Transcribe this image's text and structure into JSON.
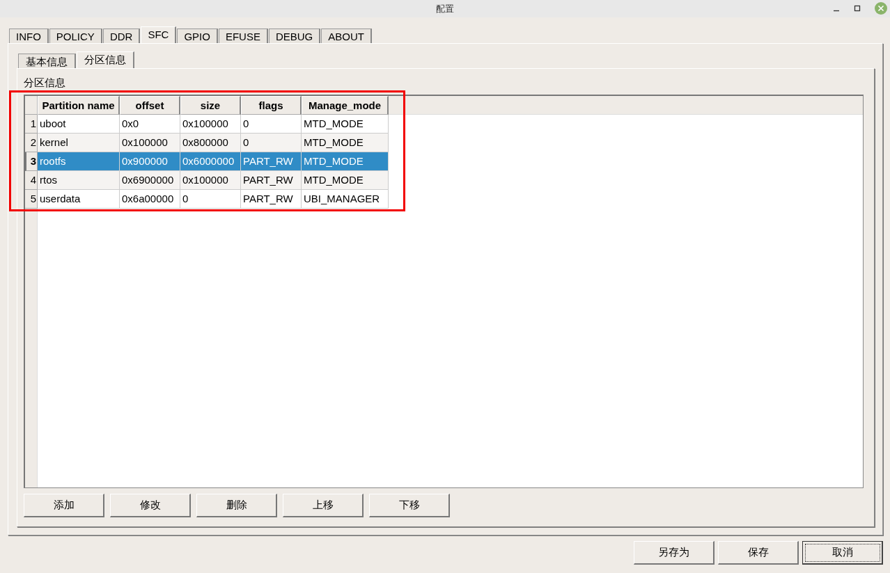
{
  "window": {
    "title": "配置"
  },
  "tabs": [
    {
      "label": "INFO",
      "selected": false
    },
    {
      "label": "POLICY",
      "selected": false
    },
    {
      "label": "DDR",
      "selected": false
    },
    {
      "label": "SFC",
      "selected": true
    },
    {
      "label": "GPIO",
      "selected": false
    },
    {
      "label": "EFUSE",
      "selected": false
    },
    {
      "label": "DEBUG",
      "selected": false
    },
    {
      "label": "ABOUT",
      "selected": false
    }
  ],
  "subtabs": [
    {
      "label": "基本信息",
      "selected": false
    },
    {
      "label": "分区信息",
      "selected": true
    }
  ],
  "group_label": "分区信息",
  "table": {
    "columns": [
      "Partition name",
      "offset",
      "size",
      "flags",
      "Manage_mode"
    ],
    "rows": [
      {
        "number": "1",
        "selected": false,
        "cells": [
          "uboot",
          "0x0",
          "0x100000",
          "0",
          "MTD_MODE"
        ]
      },
      {
        "number": "2",
        "selected": false,
        "cells": [
          "kernel",
          "0x100000",
          "0x800000",
          "0",
          "MTD_MODE"
        ]
      },
      {
        "number": "3",
        "selected": true,
        "cells": [
          "rootfs",
          "0x900000",
          "0x6000000",
          "PART_RW",
          "MTD_MODE"
        ]
      },
      {
        "number": "4",
        "selected": false,
        "cells": [
          "rtos",
          "0x6900000",
          "0x100000",
          "PART_RW",
          "MTD_MODE"
        ]
      },
      {
        "number": "5",
        "selected": false,
        "cells": [
          "userdata",
          "0x6a00000",
          "0",
          "PART_RW",
          "UBI_MANAGER"
        ]
      }
    ]
  },
  "table_buttons": [
    "添加",
    "修改",
    "删除",
    "上移",
    "下移"
  ],
  "dialog_buttons": [
    {
      "label": "另存为",
      "focused": false
    },
    {
      "label": "保存",
      "focused": false
    },
    {
      "label": "取消",
      "focused": true
    }
  ]
}
